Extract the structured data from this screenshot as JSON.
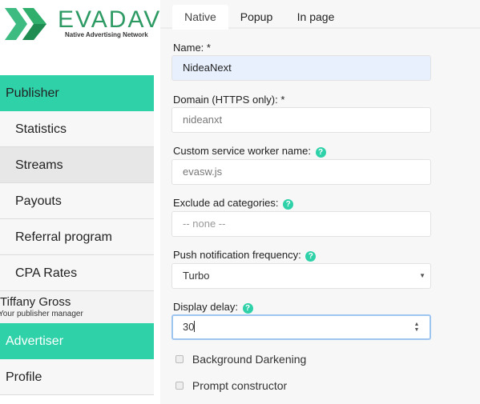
{
  "logo": {
    "brand": "EVADAV",
    "tagline": "Native Advertising Network"
  },
  "sidebar": {
    "publisher_section": "Publisher",
    "items": [
      {
        "label": "Statistics",
        "active": false
      },
      {
        "label": "Streams",
        "active": true
      },
      {
        "label": "Payouts",
        "active": false
      },
      {
        "label": "Referral program",
        "active": false
      },
      {
        "label": "CPA Rates",
        "active": false
      }
    ],
    "manager": {
      "name": "Tiffany Gross",
      "role": "Your publisher manager"
    },
    "advertiser_section": "Advertiser",
    "profile": "Profile"
  },
  "tabs": [
    {
      "label": "Native",
      "active": true
    },
    {
      "label": "Popup",
      "active": false
    },
    {
      "label": "In page",
      "active": false
    }
  ],
  "form": {
    "name": {
      "label": "Name: *",
      "value": "NideaNext"
    },
    "domain": {
      "label": "Domain (HTTPS only): *",
      "value": "nideanxt"
    },
    "service_worker": {
      "label": "Custom service worker name:",
      "value": "evasw.js"
    },
    "exclude_categories": {
      "label": "Exclude ad categories:",
      "placeholder": "-- none --"
    },
    "push_frequency": {
      "label": "Push notification frequency:",
      "value": "Turbo"
    },
    "display_delay": {
      "label": "Display delay:",
      "value": "30"
    },
    "background_darkening": {
      "label": "Background Darkening",
      "checked": false
    },
    "prompt_constructor": {
      "label": "Prompt constructor",
      "checked": false
    },
    "help_glyph": "?"
  },
  "colors": {
    "accent": "#2fd1a9",
    "brand_green": "#2e9a63",
    "autofill": "#e8f0fe"
  }
}
